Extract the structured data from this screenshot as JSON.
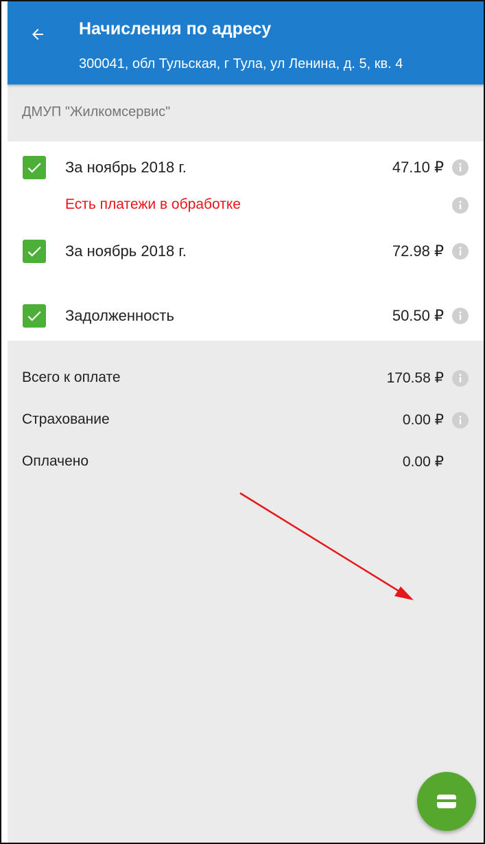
{
  "header": {
    "title": "Начисления по адресу",
    "subtitle": "300041, обл Тульская, г Тула, ул Ленина, д. 5, кв. 4",
    "back_icon": "arrow-left-icon",
    "background": "#1e7ecd"
  },
  "provider": {
    "name": "ДМУП \"Жилкомсервис\""
  },
  "charges": [
    {
      "label": "За ноябрь 2018 г.",
      "amount": "47.10 ₽",
      "checked": true
    },
    {
      "warning": "Есть платежи в обработке"
    },
    {
      "label": "За ноябрь 2018 г.",
      "amount": "72.98 ₽",
      "checked": true
    },
    {
      "label": "Задолженность",
      "amount": "50.50 ₽",
      "checked": true
    }
  ],
  "summary": [
    {
      "label": "Всего к оплате",
      "amount": "170.58 ₽",
      "has_info": true
    },
    {
      "label": "Страхование",
      "amount": "0.00 ₽",
      "has_info": true
    },
    {
      "label": "Оплачено",
      "amount": "0.00 ₽",
      "has_info": false
    }
  ],
  "fab": {
    "icon": "credit-card-icon",
    "color": "#55a82d"
  },
  "annotation": {
    "arrow_color": "#e8161b"
  },
  "colors": {
    "checkbox": "#4caf37",
    "warning_text": "#e8161b",
    "info_icon": "#cfcfcf"
  }
}
